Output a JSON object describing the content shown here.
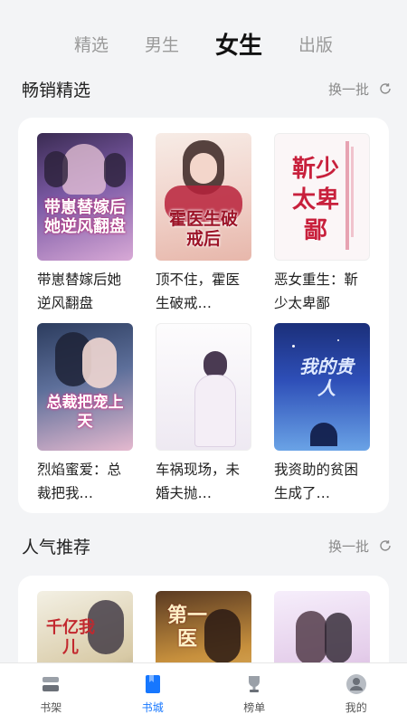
{
  "top_tabs": [
    {
      "label": "精选"
    },
    {
      "label": "男生"
    },
    {
      "label": "女生"
    },
    {
      "label": "出版"
    }
  ],
  "sections": [
    {
      "title": "畅销精选",
      "refresh_label": "换一批",
      "books": [
        {
          "title": "带崽替嫁后她逆风翻盘",
          "cover_text": "带崽替嫁后她逆风翻盘"
        },
        {
          "title": "顶不住，霍医生破戒…",
          "cover_text": "霍医生破戒后"
        },
        {
          "title": "恶女重生：靳少太卑鄙",
          "cover_text": "靳少太卑鄙"
        },
        {
          "title": "烈焰蜜爱：总裁把我…",
          "cover_text": "总裁把宠上天"
        },
        {
          "title": "车祸现场，未婚夫抛…",
          "cover_text": ""
        },
        {
          "title": "我资助的贫困生成了…",
          "cover_text": "我的贵人"
        }
      ]
    },
    {
      "title": "人气推荐",
      "refresh_label": "换一批",
      "books": [
        {
          "title": "",
          "cover_text": "千亿我儿"
        },
        {
          "title": "",
          "cover_text": "第一医"
        },
        {
          "title": "",
          "cover_text": ""
        }
      ]
    }
  ],
  "bottom_nav": [
    {
      "label": "书架",
      "icon": "bookshelf-icon"
    },
    {
      "label": "书城",
      "icon": "bookstore-icon",
      "active": true
    },
    {
      "label": "榜单",
      "icon": "trophy-icon"
    },
    {
      "label": "我的",
      "icon": "profile-icon"
    }
  ],
  "colors": {
    "accent": "#1677ff",
    "background": "#f3f4f6"
  }
}
